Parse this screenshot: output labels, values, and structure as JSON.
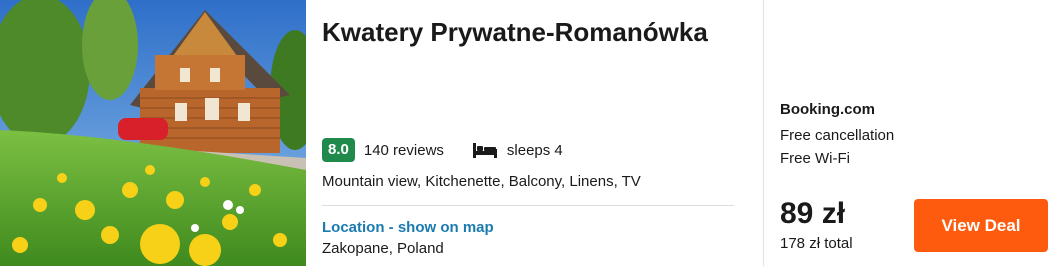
{
  "listing": {
    "title": "Kwatery Prywatne-Romanówka",
    "rating": "8.0",
    "reviews": "140 reviews",
    "sleeps": "sleeps 4",
    "amenities": "Mountain view, Kitchenette, Balcony, Linens, TV",
    "location_link": "Location - show on map",
    "location": "Zakopane, Poland",
    "icons": [
      "bed-icon"
    ],
    "colors": {
      "rating": "#1f8a4c",
      "link": "#1b7bb0",
      "cta": "#ff5b0f"
    }
  },
  "deal": {
    "provider": "Booking.com",
    "features": [
      "Free cancellation",
      "Free Wi-Fi"
    ],
    "price": "89 zł",
    "total": "178 zł total",
    "cta_label": "View Deal"
  }
}
